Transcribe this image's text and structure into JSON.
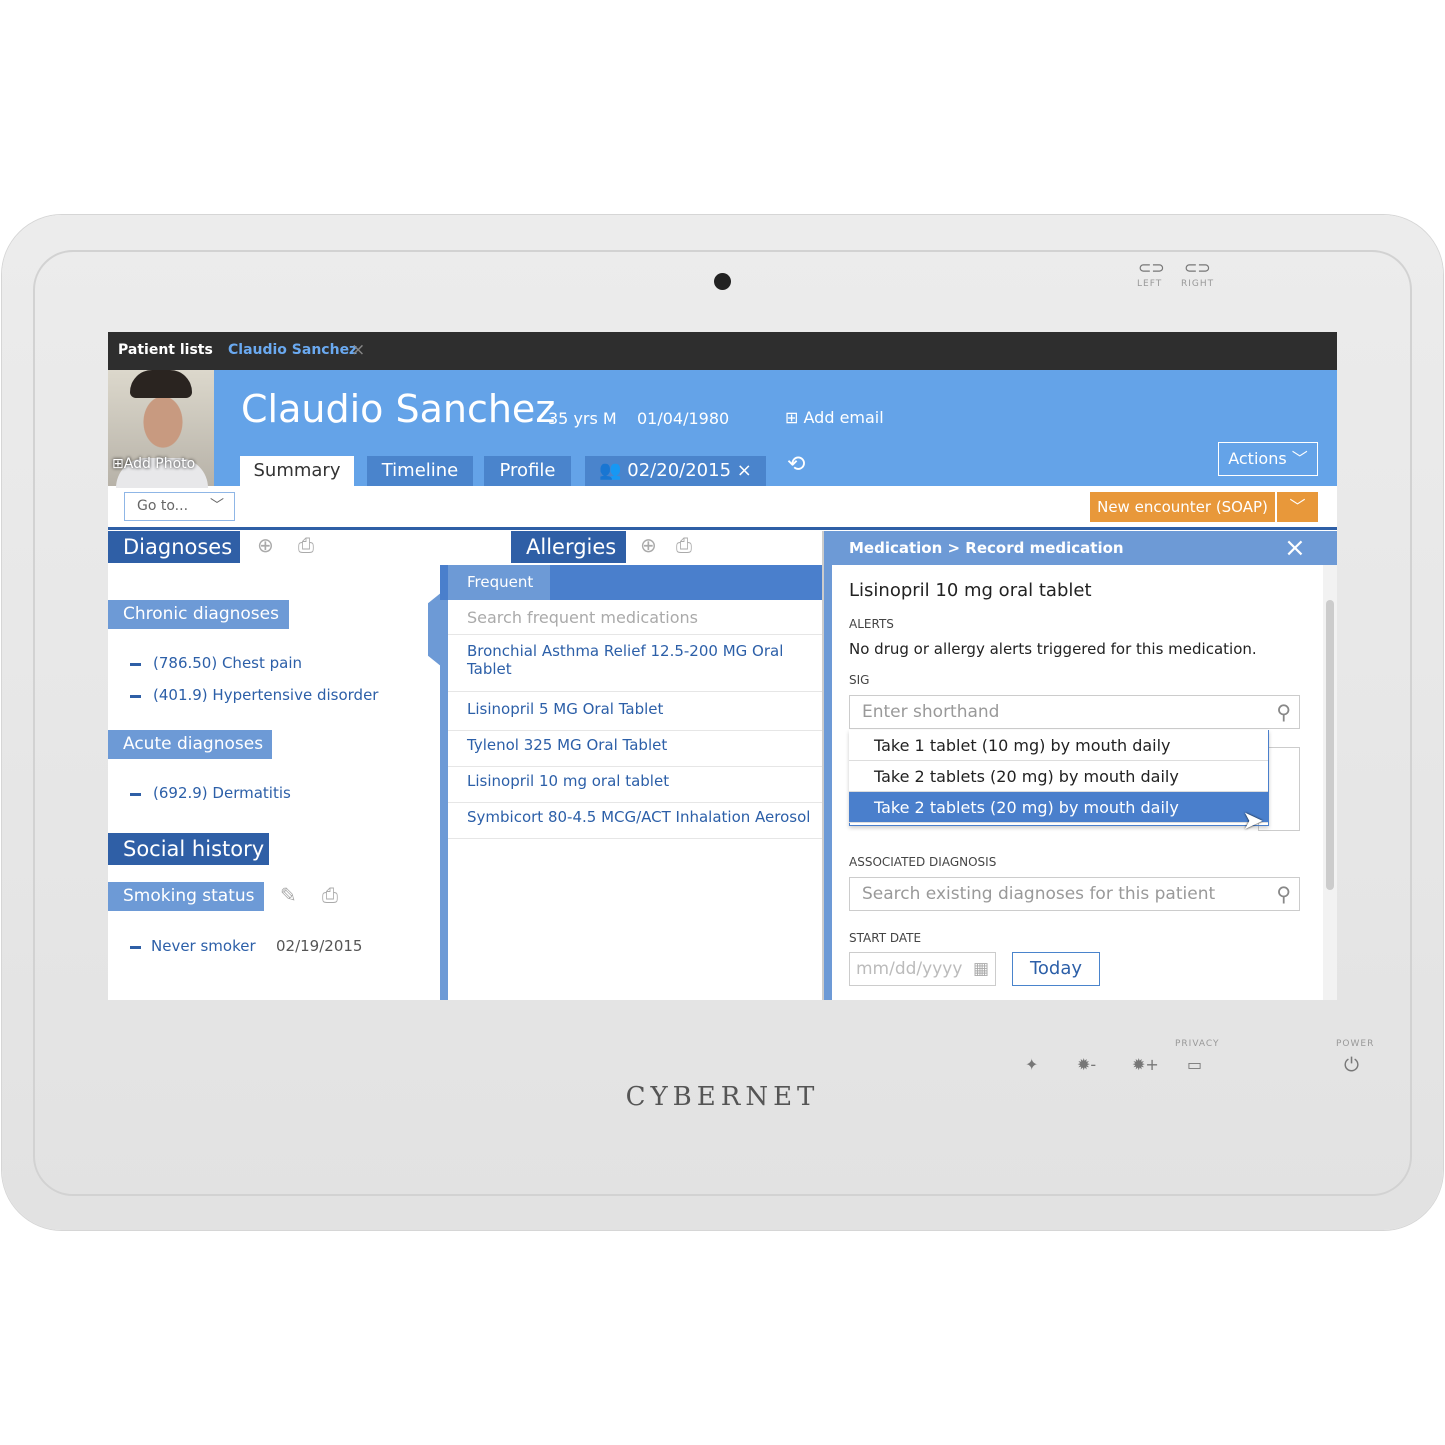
{
  "device": {
    "brand": "CYBERNET",
    "top_buttons": [
      "LEFT",
      "RIGHT"
    ],
    "privacy_label": "PRIVACY",
    "power_label": "POWER"
  },
  "topbar": {
    "patient_lists": "Patient lists",
    "open_tab": "Claudio Sanchez"
  },
  "patient": {
    "name": "Claudio Sanchez",
    "age_sex": "35 yrs M",
    "dob": "01/04/1980",
    "add_email": "Add email",
    "add_photo": "Add Photo"
  },
  "tabs": [
    {
      "label": "Summary",
      "active": true
    },
    {
      "label": "Timeline"
    },
    {
      "label": "Profile"
    },
    {
      "label": "02/20/2015"
    }
  ],
  "actions_label": "Actions",
  "goto_label": "Go to...",
  "new_encounter_label": "New encounter (SOAP)",
  "colors": {
    "header": "#64a3e8",
    "tab": "#4a84cc",
    "section": "#2f5fa6",
    "accent_orange": "#e8983a",
    "topbar": "#2e2e2e"
  },
  "diagnoses": {
    "title": "Diagnoses",
    "chronic_title": "Chronic diagnoses",
    "chronic": [
      "(786.50) Chest pain",
      "(401.9) Hypertensive disorder"
    ],
    "acute_title": "Acute diagnoses",
    "acute": [
      "(692.9) Dermatitis"
    ]
  },
  "social": {
    "title": "Social history",
    "smoking_title": "Smoking status",
    "status": "Never smoker",
    "date": "02/19/2015"
  },
  "allergies": {
    "title": "Allergies"
  },
  "frequent": {
    "tab": "Frequent",
    "placeholder": "Search frequent medications",
    "items": [
      "Bronchial Asthma Relief 12.5-200 MG Oral Tablet",
      "Lisinopril 5 MG Oral Tablet",
      "Tylenol 325 MG Oral Tablet",
      "Lisinopril 10 mg oral tablet",
      "Symbicort 80-4.5 MCG/ACT Inhalation Aerosol"
    ]
  },
  "record": {
    "breadcrumb": "Medication > Record medication",
    "med_name": "Lisinopril 10 mg oral tablet",
    "alerts_label": "ALERTS",
    "alerts_text": "No drug or allergy alerts triggered for this medication.",
    "sig_label": "SIG",
    "sig_placeholder": "Enter shorthand",
    "sig_options": [
      "Take 1 tablet (10 mg) by mouth daily",
      "Take 2 tablets (20 mg) by mouth daily",
      "Take 2 tablets (20 mg) by mouth daily"
    ],
    "sig_selected_index": 2,
    "assoc_label": "ASSOCIATED DIAGNOSIS",
    "assoc_placeholder": "Search existing diagnoses for this patient",
    "start_label": "START DATE",
    "date_placeholder": "mm/dd/yyyy",
    "today_label": "Today"
  }
}
